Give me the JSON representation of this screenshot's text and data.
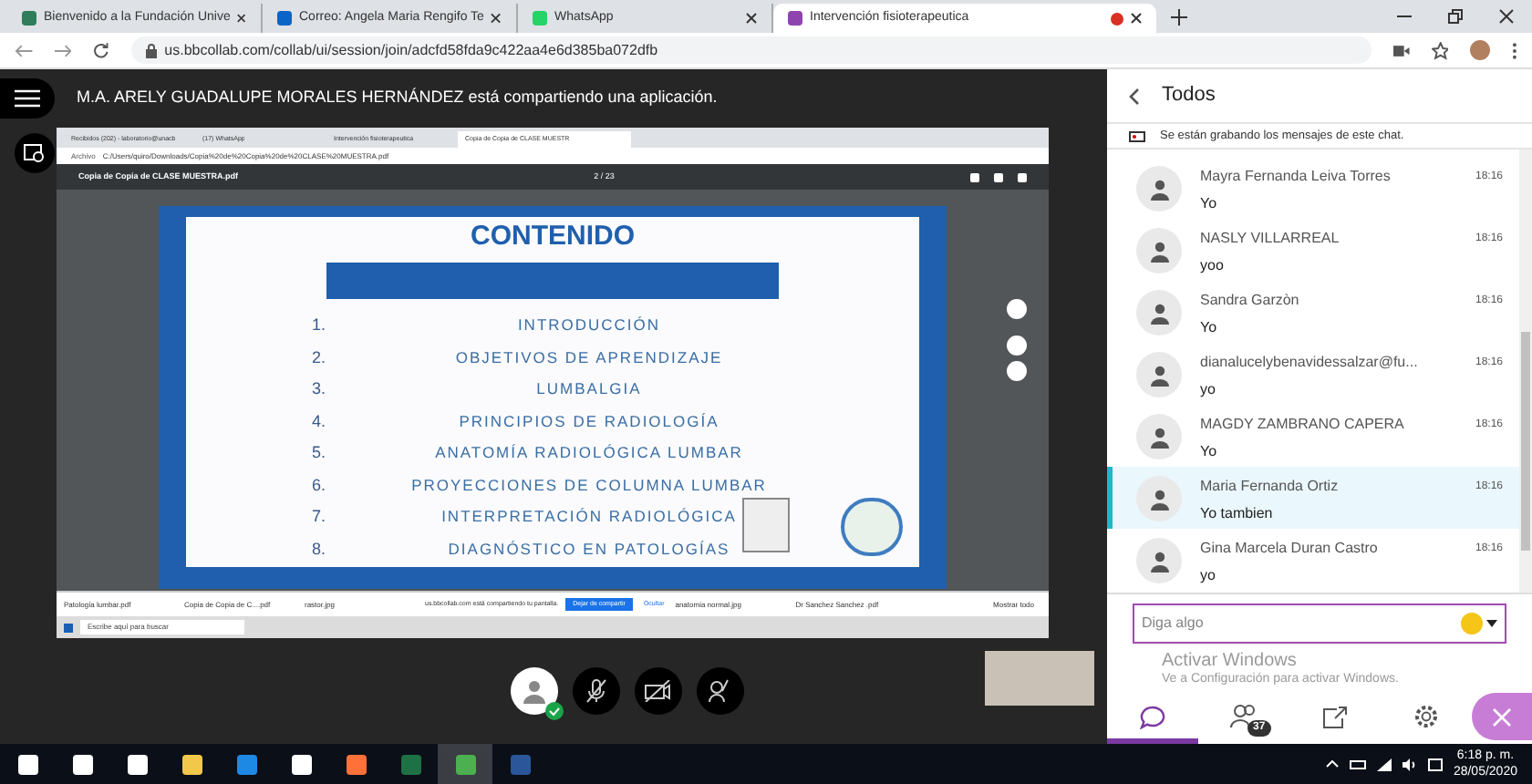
{
  "browser": {
    "tabs": [
      {
        "title": "Bienvenido a la Fundación Unive",
        "selected": false,
        "recording": false
      },
      {
        "title": "Correo: Angela Maria Rengifo Te",
        "selected": false,
        "recording": false
      },
      {
        "title": "WhatsApp",
        "selected": false,
        "recording": false
      },
      {
        "title": "Intervención fisioterapeutica",
        "selected": true,
        "recording": true
      }
    ],
    "url": "us.bbcollab.com/collab/ui/session/join/adcfd58fda9c422aa4e6d385ba072dfb"
  },
  "share_banner": "M.A. ARELY GUADALUPE MORALES HERNÁNDEZ está compartiendo una aplicación.",
  "shared_screen": {
    "tabs": [
      {
        "title": "Recibidos (202) - laboratorio@unacb",
        "selected": false
      },
      {
        "title": "(17) WhatsApp",
        "selected": false
      },
      {
        "title": "Intervención fisioterapeutica",
        "selected": false
      },
      {
        "title": "Copia de Copia de CLASE MUESTR",
        "selected": true
      }
    ],
    "address_label": "Archivo",
    "address": "C:/Users/quiro/Downloads/Copia%20de%20Copia%20de%20CLASE%20MUESTRA.pdf",
    "pdf_title": "Copia de Copia de CLASE MUESTRA.pdf",
    "page": "2 / 23",
    "slide": {
      "title": "CONTENIDO",
      "items": [
        {
          "number": "1.",
          "text": "INTRODUCCIÓN"
        },
        {
          "number": "2.",
          "text": "OBJETIVOS DE APRENDIZAJE"
        },
        {
          "number": "3.",
          "text": "LUMBALGIA"
        },
        {
          "number": "4.",
          "text": "PRINCIPIOS DE RADIOLOGÍA"
        },
        {
          "number": "5.",
          "text": "ANATOMÍA RADIOLÓGICA LUMBAR"
        },
        {
          "number": "6.",
          "text": "PROYECCIONES DE COLUMNA LUMBAR"
        },
        {
          "number": "7.",
          "text": "INTERPRETACIÓN RADIOLÓGICA"
        },
        {
          "number": "8.",
          "text": "DIAGNÓSTICO EN PATOLOGÍAS"
        }
      ]
    },
    "downloads": [
      "Patología lumbar.pdf",
      "Copia de Copia de C....pdf",
      "rastor.jpg"
    ],
    "sharing_notice": "us.bbcollab.com está compartiendo tu pantalla.",
    "stop_button": "Dejar de compartir",
    "hide_button": "Ocultar",
    "downloads_right": [
      "anatomia normal.jpg",
      "Dr Sanchez Sanchez .pdf"
    ],
    "show_all": "Mostrar todo",
    "search_placeholder": "Escribe aquí para buscar"
  },
  "chat": {
    "title": "Todos",
    "recording_notice": "Se están grabando los mensajes de este chat.",
    "messages": [
      {
        "name": "Mayra Fernanda Leiva Torres",
        "text": "Yo",
        "time": "18:16",
        "selected": false
      },
      {
        "name": "NASLY VILLARREAL",
        "text": "yoo",
        "time": "18:16",
        "selected": false
      },
      {
        "name": "Sandra Garzòn",
        "text": "Yo",
        "time": "18:16",
        "selected": false
      },
      {
        "name": "dianalucelybenavidessalzar@fu...",
        "text": "yo",
        "time": "18:16",
        "selected": false
      },
      {
        "name": "MAGDY ZAMBRANO CAPERA",
        "text": "Yo",
        "time": "18:16",
        "selected": false
      },
      {
        "name": "Maria Fernanda Ortiz",
        "text": "Yo tambien",
        "time": "18:16",
        "selected": true
      },
      {
        "name": "Gina Marcela Duran Castro",
        "text": "yo",
        "time": "18:16",
        "selected": false
      }
    ],
    "input_placeholder": "Diga algo",
    "participants_count": "37"
  },
  "activation": {
    "title": "Activar Windows",
    "text": "Ve a Configuración para activar Windows."
  },
  "taskbar": {
    "time": "6:18 p. m.",
    "date": "28/05/2020"
  }
}
